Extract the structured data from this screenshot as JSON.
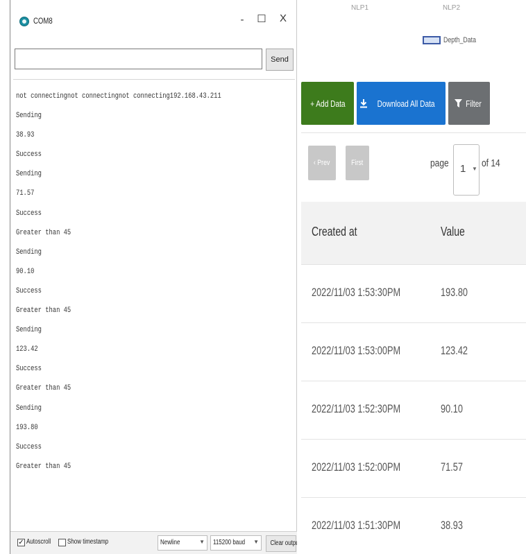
{
  "serial_monitor": {
    "title": "COM8",
    "window_buttons": {
      "minimize": "-",
      "maximize": "☐",
      "close": "X"
    },
    "input_value": "",
    "send_label": "Send",
    "output_lines": [
      "not connectingnot connectingnot connecting192.168.43.211",
      "Sending",
      "38.93",
      "Success",
      "Sending",
      "71.57",
      "Success",
      "Greater than 45",
      "Sending",
      "90.10",
      "Success",
      "Greater than 45",
      "Sending",
      "123.42",
      "Success",
      "Greater than 45",
      "Sending",
      "193.80",
      "Success",
      "Greater than 45"
    ],
    "status_bar": {
      "autoscroll_label": "Autoscroll",
      "autoscroll_checked": true,
      "timestamp_label": "Show timestamp",
      "timestamp_checked": false,
      "line_ending": "Newline",
      "baud_rate": "115200 baud",
      "clear_label": "Clear output"
    }
  },
  "dashboard": {
    "legend_small": [
      "NLP1",
      "NLP2"
    ],
    "legend_label": "Depth_Data",
    "buttons": {
      "add": "+ Add Data",
      "download": "Download All Data",
      "filter": "Filter"
    },
    "pagination": {
      "prev": "‹ Prev",
      "first": "First",
      "page_word": "page",
      "current_page": "1",
      "of_total": "of 14"
    },
    "table": {
      "headers": [
        "Created at",
        "Value"
      ],
      "rows": [
        [
          "2022/11/03 1:53:30PM",
          "193.80"
        ],
        [
          "2022/11/03 1:53:00PM",
          "123.42"
        ],
        [
          "2022/11/03 1:52:30PM",
          "90.10"
        ],
        [
          "2022/11/03 1:52:00PM",
          "71.57"
        ],
        [
          "2022/11/03 1:51:30PM",
          "38.93"
        ]
      ]
    },
    "colors": {
      "add_button": "#3d7b1c",
      "download_button": "#1a73d0",
      "filter_button": "#6c6f72"
    }
  }
}
